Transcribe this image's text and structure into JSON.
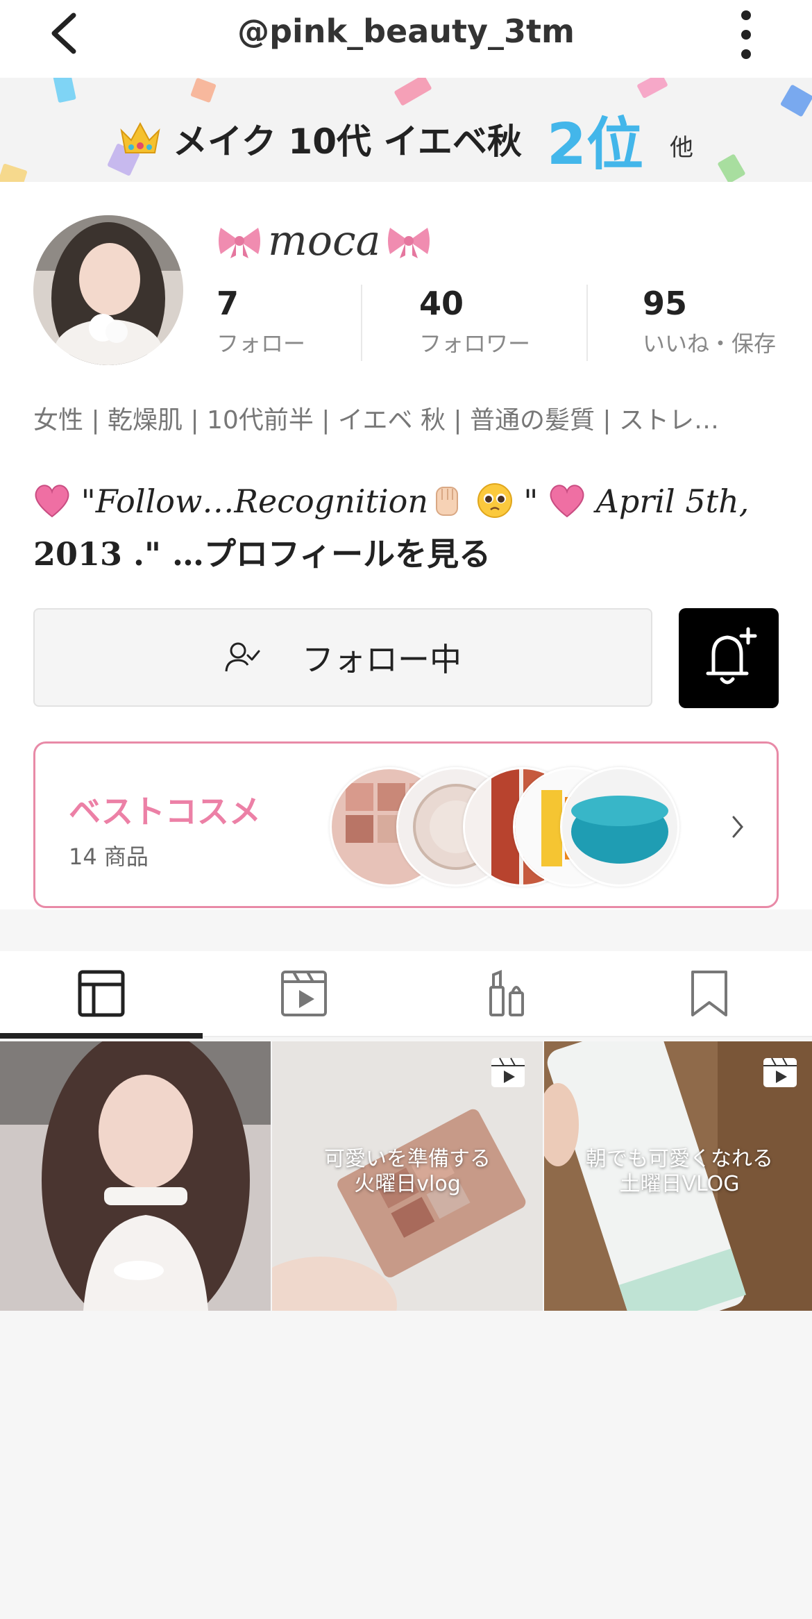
{
  "header": {
    "title": "@pink_beauty_3tm"
  },
  "rank": {
    "label": "メイク 10代 イエベ秋",
    "position": "2位",
    "other": "他"
  },
  "profile": {
    "name": "moca",
    "stats": [
      {
        "value": "7",
        "label": "フォロー"
      },
      {
        "value": "40",
        "label": "フォロワー"
      },
      {
        "value": "95",
        "label": "いいね・保存"
      }
    ],
    "tags": "女性 | 乾燥肌 | 10代前半 | イエベ 秋 | 普通の髪質 | ストレ…",
    "bio": {
      "part1": "\"Follow…Recognition",
      "part2": "\"",
      "part3": "April 5th,",
      "part4": "2013 .\" …",
      "more": "プロフィールを見る"
    }
  },
  "actions": {
    "follow_label": "フォロー中"
  },
  "best_cosme": {
    "title": "ベストコスメ",
    "count": "14 商品"
  },
  "tabs": [
    "posts-grid-icon",
    "videos-icon",
    "cosmetics-icon",
    "bookmark-icon"
  ],
  "posts": [
    {
      "caption_line1": "",
      "caption_line2": ""
    },
    {
      "caption_line1": "可愛いを準備する",
      "caption_line2": "火曜日vlog"
    },
    {
      "caption_line1": "朝でも可愛くなれる",
      "caption_line2": "土曜日VLOG"
    }
  ],
  "colors": {
    "accent_blue": "#43b6ea",
    "pink": "#ec80a6",
    "border_pink": "#e88aa7"
  }
}
